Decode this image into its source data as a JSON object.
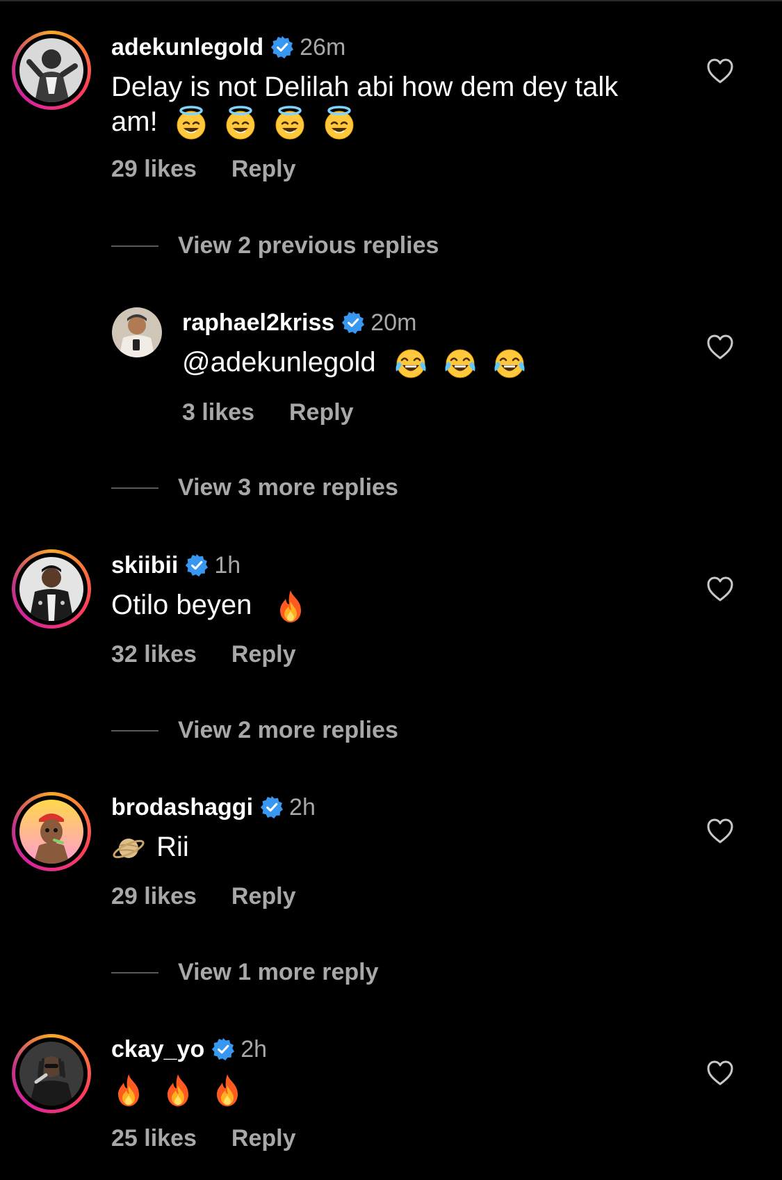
{
  "comments": [
    {
      "username": "adekunlegold",
      "time": "26m",
      "text_line1": "Delay is not Delilah abi how dem dey talk",
      "text_line2": "am!",
      "emoji": "halo-smile",
      "likes": "29 likes",
      "reply_label": "Reply"
    },
    {
      "username": "raphael2kriss",
      "time": "20m",
      "text": "@adekunlegold",
      "emoji": "tears-of-joy",
      "likes": "3 likes",
      "reply_label": "Reply"
    },
    {
      "username": "skiibii",
      "time": "1h",
      "text": "Otilo beyen",
      "emoji": "fire",
      "likes": "32 likes",
      "reply_label": "Reply"
    },
    {
      "username": "brodashaggi",
      "time": "2h",
      "text": "Rii",
      "emoji": "ringed-planet",
      "likes": "29 likes",
      "reply_label": "Reply"
    },
    {
      "username": "ckay_yo",
      "time": "2h",
      "emoji": "fire",
      "likes": "25 likes",
      "reply_label": "Reply"
    }
  ],
  "threads": [
    {
      "label": "View 2 previous replies"
    },
    {
      "label": "View 3 more replies"
    },
    {
      "label": "View 2 more replies"
    },
    {
      "label": "View 1 more reply"
    }
  ],
  "icons": {
    "verified": "verified-badge-icon",
    "like": "heart-outline-icon"
  },
  "colors": {
    "background": "#000000",
    "secondary_text": "#a8a8a8",
    "verified_blue": "#3897f0"
  }
}
